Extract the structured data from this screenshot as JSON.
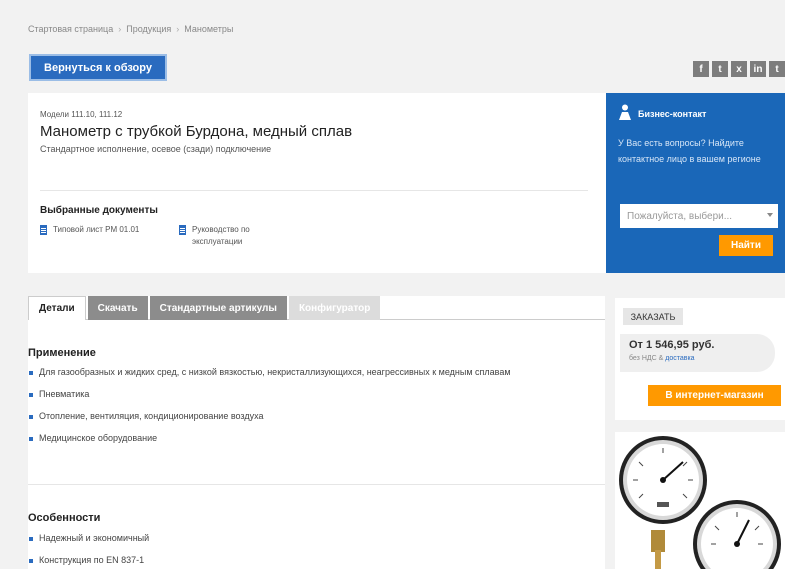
{
  "breadcrumb": [
    "Стартовая страница",
    "Продукция",
    "Манометры"
  ],
  "breadcrumb_sep": "›",
  "back_button": "Вернуться к обзору",
  "social": [
    "f",
    "t",
    "x",
    "in",
    "t"
  ],
  "product": {
    "models": "Модели 111.10, 111.12",
    "title": "Манометр с трубкой Бурдона, медный сплав",
    "subtitle": "Стандартное исполнение, осевое (сзади) подключение",
    "docs_title": "Выбранные документы",
    "docs": [
      "Типовой лист PM 01.01",
      "Руководство по эксплуатации"
    ]
  },
  "business_contact": {
    "title": "Бизнес-контакт",
    "text": "У Вас есть вопросы? Найдите контактное лицо в вашем регионе",
    "select_placeholder": "Пожалуйста, выбери...",
    "button": "Найти"
  },
  "tabs": [
    "Детали",
    "Скачать",
    "Стандартные артикулы",
    "Конфигуратор"
  ],
  "application": {
    "title": "Применение",
    "items": [
      "Для газообразных и жидких сред, с низкой вязкостью, некристаллизующихся, неагрессивных к медным сплавам",
      "Пневматика",
      "Отопление, вентиляция, кондиционирование воздуха",
      "Медицинское оборудование"
    ]
  },
  "features": {
    "title": "Особенности",
    "items": [
      "Надежный и экономичный",
      "Конструкция по EN 837-1"
    ]
  },
  "order": {
    "label": "ЗАКАЗАТЬ",
    "price": "От 1 546,95 руб.",
    "vat_prefix": "без НДС &",
    "vat_link": "доставка",
    "shop_button": "В интернет-магазин"
  },
  "colors": {
    "accent": "#2a6bbf",
    "orange": "#ff9900",
    "contact_bg": "#1a67b8"
  }
}
